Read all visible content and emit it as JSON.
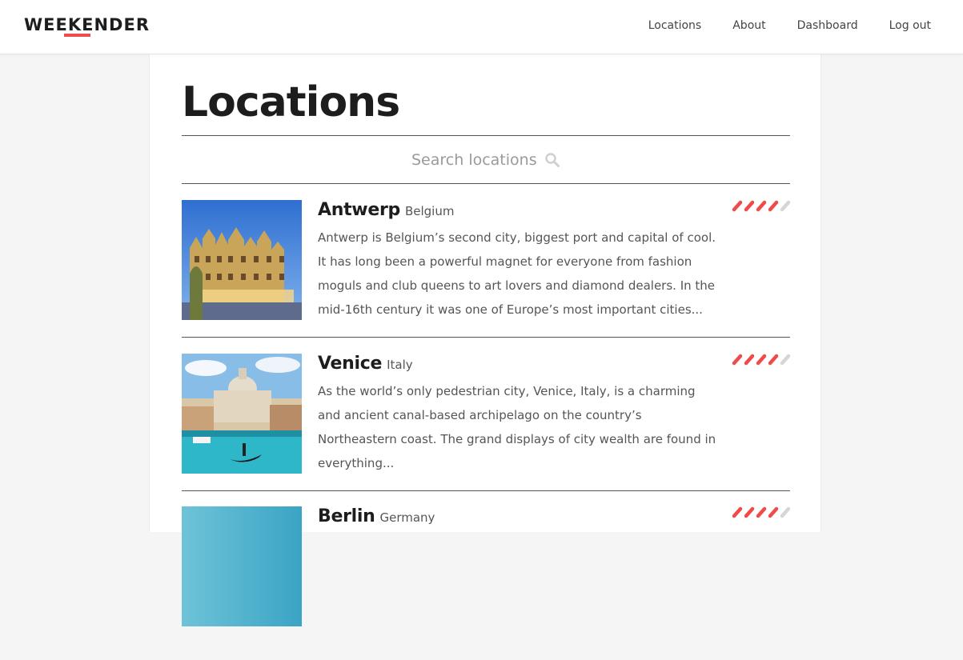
{
  "header": {
    "logo": "WEEKENDER",
    "nav": [
      "Locations",
      "About",
      "Dashboard",
      "Log out"
    ]
  },
  "colors": {
    "accent": "#ef4b4b",
    "rating_empty": "#d6d6d6"
  },
  "page": {
    "title": "Locations",
    "search_placeholder": "Search locations"
  },
  "locations": [
    {
      "name": "Antwerp",
      "country": "Belgium",
      "description": "Antwerp is Belgium’s second city, biggest port and capital of cool. It has long been a powerful magnet for everyone from fashion moguls and club queens to art lovers and diamond dealers. In the mid-16th century it was one of Europe’s most important cities...",
      "rating": 4,
      "rating_max": 5
    },
    {
      "name": "Venice",
      "country": "Italy",
      "description": "As the world’s only pedestrian city, Venice, Italy, is a charming and ancient canal-based archipelago on the country’s Northeastern coast. The grand displays of city wealth are found in everything...",
      "rating": 4,
      "rating_max": 5
    },
    {
      "name": "Berlin",
      "country": "Germany",
      "description": "",
      "rating": 4,
      "rating_max": 5
    }
  ]
}
